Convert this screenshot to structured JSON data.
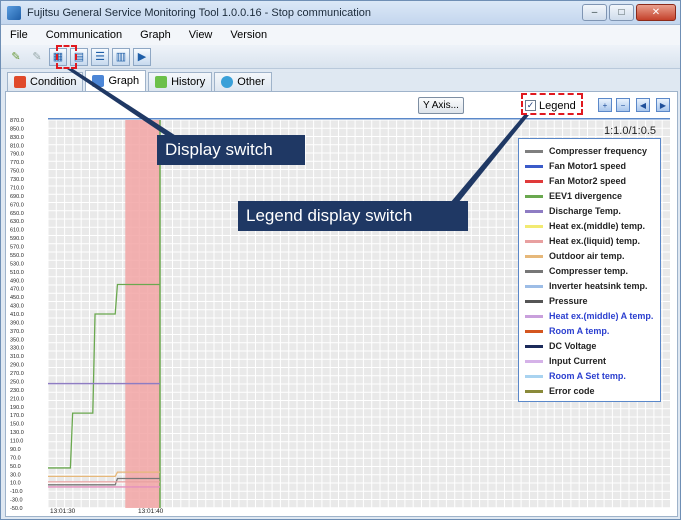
{
  "window": {
    "title": "Fujitsu General Service Monitoring Tool 1.0.0.16 - Stop communication",
    "buttons": {
      "minimize": "‒",
      "maximize": "□",
      "close": "✕"
    }
  },
  "menu": [
    "File",
    "Communication",
    "Graph",
    "View",
    "Version"
  ],
  "toolbar": {
    "icons": [
      "connect-icon",
      "disconnect-icon",
      "display-switch-icon",
      "graph-add-icon",
      "split-view-icon",
      "export-icon",
      "play-icon"
    ]
  },
  "tabs": [
    {
      "label": "Condition",
      "active": false,
      "icon_color": "#e04a2b"
    },
    {
      "label": "Graph",
      "active": true,
      "icon_color": "#4c86d6"
    },
    {
      "label": "History",
      "active": false,
      "icon_color": "#6cc04a"
    },
    {
      "label": "Other",
      "active": false,
      "icon_color": "#3aa0d8"
    }
  ],
  "graph": {
    "y_axis_button": "Y Axis...",
    "legend_checkbox": {
      "label": "Legend",
      "checked": true
    },
    "ratio_text": "1:1.0/1:0.5",
    "nav_buttons": [
      "zoom-in-icon",
      "zoom-out-icon",
      "first-page-icon",
      "last-page-icon"
    ]
  },
  "chart_data": {
    "type": "line",
    "y_ticks": [
      "870.0",
      "850.0",
      "830.0",
      "810.0",
      "790.0",
      "770.0",
      "750.0",
      "730.0",
      "710.0",
      "690.0",
      "670.0",
      "650.0",
      "630.0",
      "610.0",
      "590.0",
      "570.0",
      "550.0",
      "530.0",
      "510.0",
      "490.0",
      "470.0",
      "450.0",
      "430.0",
      "410.0",
      "390.0",
      "370.0",
      "350.0",
      "330.0",
      "310.0",
      "290.0",
      "270.0",
      "250.0",
      "230.0",
      "210.0",
      "190.0",
      "170.0",
      "150.0",
      "130.0",
      "110.0",
      "90.0",
      "70.0",
      "50.0",
      "30.0",
      "10.0",
      "-10.0",
      "-30.0",
      "-50.0"
    ],
    "ylim": [
      -50,
      870
    ],
    "x_ticks": [
      "13:01:30",
      "13:01:40"
    ],
    "highlight_band": {
      "from": 0.69,
      "to": 1.0,
      "color": "#f2a5a5"
    },
    "series": [
      {
        "name": "EEV1 divergence",
        "color": "#6aa84f",
        "points": [
          [
            0,
            45
          ],
          [
            0.2,
            45
          ],
          [
            0.22,
            175
          ],
          [
            0.4,
            175
          ],
          [
            0.42,
            410
          ],
          [
            0.6,
            410
          ],
          [
            0.62,
            480
          ],
          [
            1.0,
            480
          ]
        ]
      },
      {
        "name": "Discharge Temp.",
        "color": "#8e7cc3",
        "points": [
          [
            0,
            245
          ],
          [
            1.0,
            245
          ]
        ]
      },
      {
        "name": "Outdoor air temp.",
        "color": "#e6b87a",
        "points": [
          [
            0,
            25
          ],
          [
            0.6,
            25
          ],
          [
            0.62,
            35
          ],
          [
            1.0,
            35
          ]
        ]
      },
      {
        "name": "Compressor temp.",
        "color": "#777777",
        "points": [
          [
            0,
            5
          ],
          [
            0.6,
            5
          ],
          [
            0.62,
            20
          ],
          [
            1.0,
            20
          ]
        ]
      },
      {
        "name": "Heat ex.(liquid)temp.",
        "color": "#e8a0a0",
        "points": [
          [
            0,
            12
          ],
          [
            1.0,
            12
          ]
        ]
      },
      {
        "name": "Pressure",
        "color": "#e48fbf",
        "points": [
          [
            0,
            0
          ],
          [
            1.0,
            0
          ]
        ]
      }
    ],
    "legend": [
      {
        "label": "Compresser frequency",
        "color": "#7f7f7f",
        "blue": false
      },
      {
        "label": "Fan Motor1 speed",
        "color": "#3b5bc9",
        "blue": false
      },
      {
        "label": "Fan Motor2 speed",
        "color": "#e03a3a",
        "blue": false
      },
      {
        "label": "EEV1 divergence",
        "color": "#6aa84f",
        "blue": false
      },
      {
        "label": "Discharge Temp.",
        "color": "#8e7cc3",
        "blue": false
      },
      {
        "label": "Heat ex.(middle) temp.",
        "color": "#f2ea72",
        "blue": false
      },
      {
        "label": "Heat ex.(liquid) temp.",
        "color": "#e8a0a0",
        "blue": false
      },
      {
        "label": "Outdoor air temp.",
        "color": "#e6b87a",
        "blue": false
      },
      {
        "label": "Compresser temp.",
        "color": "#777777",
        "blue": false
      },
      {
        "label": "Inverter heatsink temp.",
        "color": "#9dbde6",
        "blue": false
      },
      {
        "label": "Pressure",
        "color": "#555555",
        "blue": false
      },
      {
        "label": "Heat ex.(middle) A temp.",
        "color": "#c9a0dc",
        "blue": true
      },
      {
        "label": "Room A temp.",
        "color": "#d4561f",
        "blue": true
      },
      {
        "label": "DC Voltage",
        "color": "#1b2a5a",
        "blue": false
      },
      {
        "label": "Input Current",
        "color": "#d5b2e8",
        "blue": false
      },
      {
        "label": "Room A Set temp.",
        "color": "#a9d3f0",
        "blue": true
      },
      {
        "label": "Error code",
        "color": "#8a8a3a",
        "blue": false
      }
    ]
  },
  "callouts": {
    "display_switch": "Display switch",
    "legend_display_switch": "Legend display switch"
  }
}
